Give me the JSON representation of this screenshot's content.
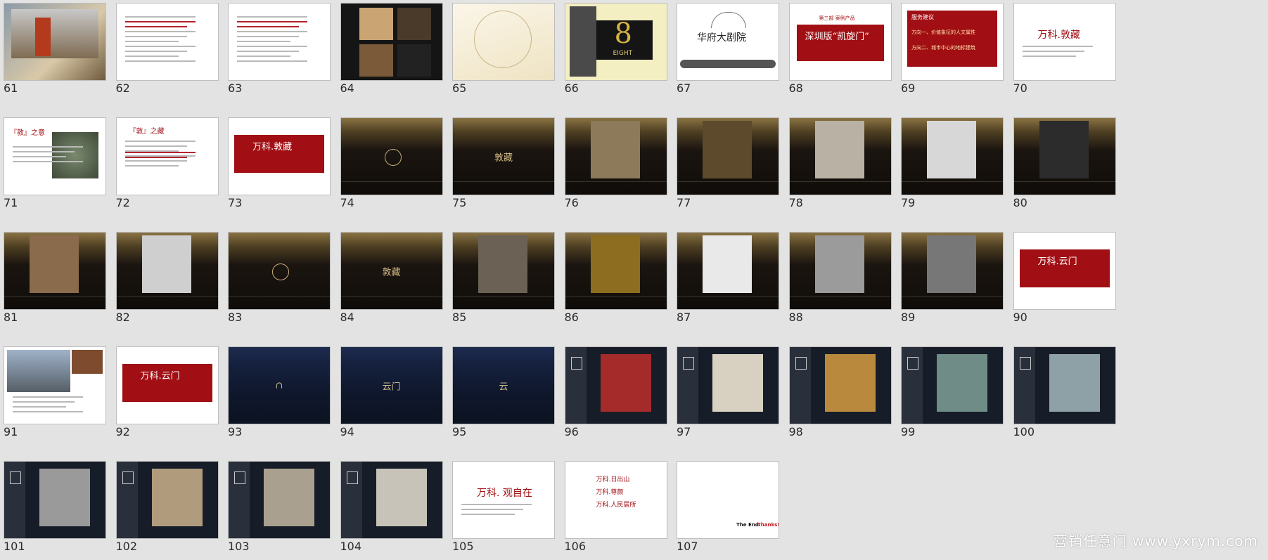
{
  "slides": [
    {
      "num": "61",
      "theme": "photo",
      "name": "slide-thumbnail-61",
      "kind": "photo"
    },
    {
      "num": "62",
      "theme": "white",
      "name": "slide-thumbnail-62",
      "kind": "textlines"
    },
    {
      "num": "63",
      "theme": "white",
      "name": "slide-thumbnail-63",
      "kind": "textlines"
    },
    {
      "num": "64",
      "theme": "white",
      "name": "slide-thumbnail-64",
      "kind": "collage"
    },
    {
      "num": "65",
      "theme": "cream",
      "name": "slide-thumbnail-65",
      "kind": "art"
    },
    {
      "num": "66",
      "theme": "white",
      "name": "slide-thumbnail-66",
      "kind": "eight",
      "text": "8",
      "sub": "EIGHT"
    },
    {
      "num": "67",
      "theme": "white",
      "name": "slide-thumbnail-67",
      "kind": "logo67",
      "text": "华府大剧院"
    },
    {
      "num": "68",
      "theme": "white",
      "name": "slide-thumbnail-68",
      "kind": "redtitle",
      "text": "深圳版“凯旋门”",
      "top": "第三部  案例产品"
    },
    {
      "num": "69",
      "theme": "white",
      "name": "slide-thumbnail-69",
      "kind": "redtitle2",
      "top": "服务建议",
      "text": "方向一、价值象征的人文属性",
      "text2": "方向二、城市中心的地标建筑"
    },
    {
      "num": "70",
      "theme": "white",
      "name": "slide-thumbnail-70",
      "kind": "plaintitle",
      "text": "万科.敦藏"
    },
    {
      "num": "71",
      "theme": "white",
      "name": "slide-thumbnail-71",
      "kind": "dun",
      "text": "『敦』之意"
    },
    {
      "num": "72",
      "theme": "white",
      "name": "slide-thumbnail-72",
      "kind": "dunlines",
      "text": "『敦』之藏"
    },
    {
      "num": "73",
      "theme": "white",
      "name": "slide-thumbnail-73",
      "kind": "redbig",
      "text": "万科.敦藏"
    },
    {
      "num": "74",
      "theme": "gold",
      "name": "slide-thumbnail-74",
      "kind": "ring"
    },
    {
      "num": "75",
      "theme": "gold",
      "name": "slide-thumbnail-75",
      "kind": "goldtext",
      "text": "敦藏"
    },
    {
      "num": "76",
      "theme": "gold",
      "name": "slide-thumbnail-76",
      "kind": "goldpic",
      "color": "#8c7a5a"
    },
    {
      "num": "77",
      "theme": "gold",
      "name": "slide-thumbnail-77",
      "kind": "goldpic",
      "color": "#5d4a2d"
    },
    {
      "num": "78",
      "theme": "gold",
      "name": "slide-thumbnail-78",
      "kind": "goldpic",
      "color": "#b8b1a4"
    },
    {
      "num": "79",
      "theme": "gold",
      "name": "slide-thumbnail-79",
      "kind": "goldpic",
      "color": "#d7d7d7"
    },
    {
      "num": "80",
      "theme": "gold",
      "name": "slide-thumbnail-80",
      "kind": "goldpic",
      "color": "#2c2c2c"
    },
    {
      "num": "81",
      "theme": "gold",
      "name": "slide-thumbnail-81",
      "kind": "goldpic",
      "color": "#8a6b4b"
    },
    {
      "num": "82",
      "theme": "gold",
      "name": "slide-thumbnail-82",
      "kind": "goldpic",
      "color": "#cfcfcf"
    },
    {
      "num": "83",
      "theme": "gold",
      "name": "slide-thumbnail-83",
      "kind": "ring"
    },
    {
      "num": "84",
      "theme": "gold",
      "name": "slide-thumbnail-84",
      "kind": "goldtext",
      "text": "敦藏"
    },
    {
      "num": "85",
      "theme": "gold",
      "name": "slide-thumbnail-85",
      "kind": "goldpic",
      "color": "#6b6255"
    },
    {
      "num": "86",
      "theme": "gold",
      "name": "slide-thumbnail-86",
      "kind": "goldpic",
      "color": "#8d6d1f"
    },
    {
      "num": "87",
      "theme": "gold",
      "name": "slide-thumbnail-87",
      "kind": "goldpic",
      "color": "#e9e9e9"
    },
    {
      "num": "88",
      "theme": "gold",
      "name": "slide-thumbnail-88",
      "kind": "goldpic",
      "color": "#9b9b9b"
    },
    {
      "num": "89",
      "theme": "gold",
      "name": "slide-thumbnail-89",
      "kind": "goldpic",
      "color": "#777777"
    },
    {
      "num": "90",
      "theme": "white",
      "name": "slide-thumbnail-90",
      "kind": "redbig",
      "text": "万科.云门"
    },
    {
      "num": "91",
      "theme": "white",
      "name": "slide-thumbnail-91",
      "kind": "bean"
    },
    {
      "num": "92",
      "theme": "white",
      "name": "slide-thumbnail-92",
      "kind": "redbig",
      "text": "万科.云门"
    },
    {
      "num": "93",
      "theme": "navy",
      "name": "slide-thumbnail-93",
      "kind": "navymark",
      "text": "∩"
    },
    {
      "num": "94",
      "theme": "navy",
      "name": "slide-thumbnail-94",
      "kind": "navymark",
      "text": "云门"
    },
    {
      "num": "95",
      "theme": "navy",
      "name": "slide-thumbnail-95",
      "kind": "navymark",
      "text": "云"
    },
    {
      "num": "96",
      "theme": "navydark",
      "name": "slide-thumbnail-96",
      "kind": "sidepic",
      "color": "#a52a2a"
    },
    {
      "num": "97",
      "theme": "navydark",
      "name": "slide-thumbnail-97",
      "kind": "sidepic",
      "color": "#d8d1c2"
    },
    {
      "num": "98",
      "theme": "navydark",
      "name": "slide-thumbnail-98",
      "kind": "sidepic",
      "color": "#b98a3e"
    },
    {
      "num": "99",
      "theme": "navydark",
      "name": "slide-thumbnail-99",
      "kind": "sidepic",
      "color": "#6f8c86"
    },
    {
      "num": "100",
      "theme": "navydark",
      "name": "slide-thumbnail-100",
      "kind": "sidepic",
      "color": "#8ea1a6"
    },
    {
      "num": "101",
      "theme": "navydark",
      "name": "slide-thumbnail-101",
      "kind": "sidepic",
      "color": "#9a9a9a"
    },
    {
      "num": "102",
      "theme": "navydark",
      "name": "slide-thumbnail-102",
      "kind": "sidepic",
      "color": "#b09c7d"
    },
    {
      "num": "103",
      "theme": "navydark",
      "name": "slide-thumbnail-103",
      "kind": "sidepic",
      "color": "#a9a08f"
    },
    {
      "num": "104",
      "theme": "navydark",
      "name": "slide-thumbnail-104",
      "kind": "sidepic",
      "color": "#c8c3b8"
    },
    {
      "num": "105",
      "theme": "white",
      "name": "slide-thumbnail-105",
      "kind": "plaintitle",
      "text": "万科. 观自在"
    },
    {
      "num": "106",
      "theme": "white",
      "name": "slide-thumbnail-106",
      "kind": "list106",
      "items": [
        "万科.日出山",
        "万科.尊颜",
        "万科.人民居所"
      ]
    },
    {
      "num": "107",
      "theme": "white",
      "name": "slide-thumbnail-107",
      "kind": "end",
      "text": "The End.",
      "text2": "Thanks!"
    }
  ],
  "watermark": "营销任意门 www.yxrym.com"
}
